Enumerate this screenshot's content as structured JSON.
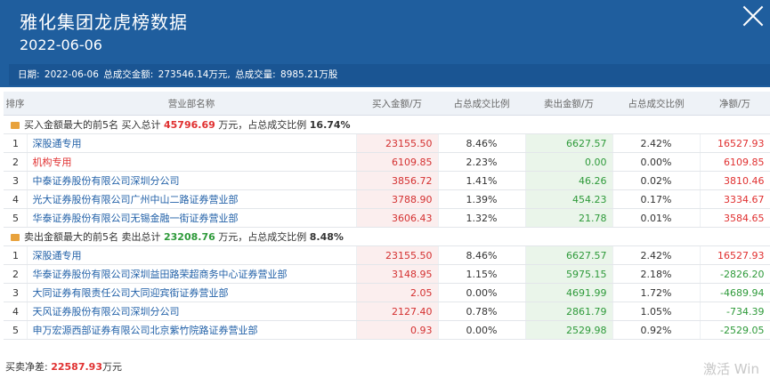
{
  "header": {
    "title": "雅化集团龙虎榜数据",
    "date": "2022-06-06",
    "info": {
      "date_label": "日期:",
      "date": "2022-06-06",
      "amount_label": "总成交金额:",
      "amount": "273546.14万元,",
      "volume_label": "总成交量:",
      "volume": "8985.21万股"
    }
  },
  "columns": [
    "排序",
    "营业部名称",
    "买入金额/万",
    "占总成交比例",
    "卖出金额/万",
    "占总成交比例",
    "净额/万"
  ],
  "buy_section": {
    "label": "买入金额最大的前5名",
    "total_label": "买入总计",
    "total": "45796.69",
    "unit": "万元，占总成交比例",
    "ratio": "16.74%"
  },
  "buy_rows": [
    {
      "idx": "1",
      "name": "深股通专用",
      "buy": "23155.50",
      "buy_pct": "8.46%",
      "sell": "6627.57",
      "sell_pct": "2.42%",
      "net": "16527.93",
      "red": false
    },
    {
      "idx": "2",
      "name": "机构专用",
      "buy": "6109.85",
      "buy_pct": "2.23%",
      "sell": "0.00",
      "sell_pct": "0.00%",
      "net": "6109.85",
      "red": true
    },
    {
      "idx": "3",
      "name": "中泰证券股份有限公司深圳分公司",
      "buy": "3856.72",
      "buy_pct": "1.41%",
      "sell": "46.26",
      "sell_pct": "0.02%",
      "net": "3810.46",
      "red": false
    },
    {
      "idx": "4",
      "name": "光大证券股份有限公司广州中山二路证券营业部",
      "buy": "3788.90",
      "buy_pct": "1.39%",
      "sell": "454.23",
      "sell_pct": "0.17%",
      "net": "3334.67",
      "red": false
    },
    {
      "idx": "5",
      "name": "华泰证券股份有限公司无锡金融一街证券营业部",
      "buy": "3606.43",
      "buy_pct": "1.32%",
      "sell": "21.78",
      "sell_pct": "0.01%",
      "net": "3584.65",
      "red": false
    }
  ],
  "sell_section": {
    "label": "卖出金额最大的前5名",
    "total_label": "卖出总计",
    "total": "23208.76",
    "unit": "万元，占总成交比例",
    "ratio": "8.48%"
  },
  "sell_rows": [
    {
      "idx": "1",
      "name": "深股通专用",
      "buy": "23155.50",
      "buy_pct": "8.46%",
      "sell": "6627.57",
      "sell_pct": "2.42%",
      "net": "16527.93",
      "neg": false
    },
    {
      "idx": "2",
      "name": "华泰证券股份有限公司深圳益田路荣超商务中心证券营业部",
      "buy": "3148.95",
      "buy_pct": "1.15%",
      "sell": "5975.15",
      "sell_pct": "2.18%",
      "net": "-2826.20",
      "neg": true
    },
    {
      "idx": "3",
      "name": "大同证券有限责任公司大同迎宾街证券营业部",
      "buy": "2.05",
      "buy_pct": "0.00%",
      "sell": "4691.99",
      "sell_pct": "1.72%",
      "net": "-4689.94",
      "neg": true
    },
    {
      "idx": "4",
      "name": "天风证券股份有限公司深圳分公司",
      "buy": "2127.40",
      "buy_pct": "0.78%",
      "sell": "2861.79",
      "sell_pct": "1.05%",
      "net": "-734.39",
      "neg": true
    },
    {
      "idx": "5",
      "name": "申万宏源西部证券有限公司北京紫竹院路证券营业部",
      "buy": "0.93",
      "buy_pct": "0.00%",
      "sell": "2529.98",
      "sell_pct": "0.92%",
      "net": "-2529.05",
      "neg": true
    }
  ],
  "footer": {
    "label": "买卖净差:",
    "value": "22587.93",
    "unit": "万元"
  },
  "watermark": "激活 Win"
}
